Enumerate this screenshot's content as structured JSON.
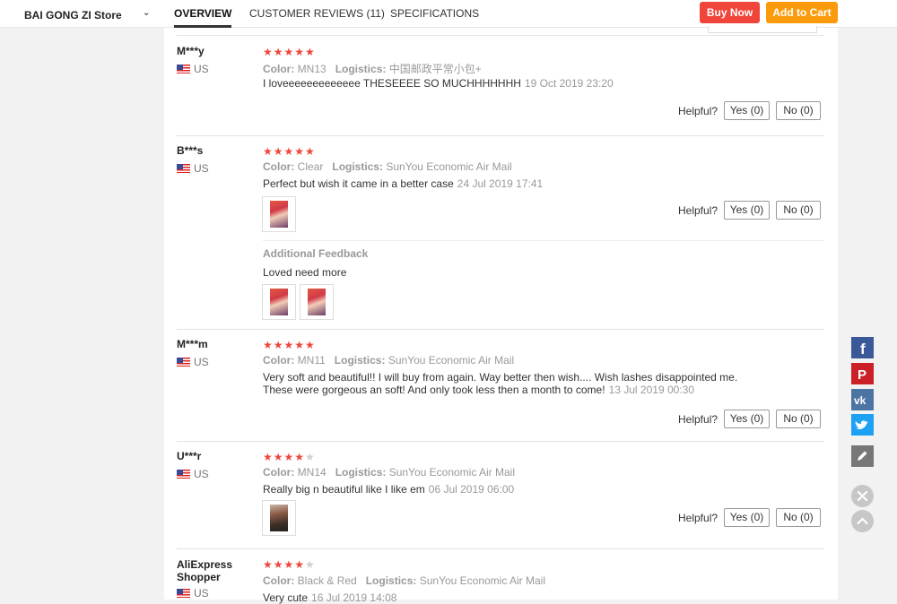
{
  "store": {
    "name": "BAI GONG ZI Store"
  },
  "tabs": [
    {
      "label": "OVERVIEW"
    },
    {
      "label": "CUSTOMER REVIEWS (11)"
    },
    {
      "label": "SPECIFICATIONS"
    }
  ],
  "actions": {
    "buy_now": "Buy Now",
    "add_to_cart": "Add to Cart"
  },
  "labels": {
    "color": "Color:",
    "logistics": "Logistics:",
    "helpful": "Helpful?",
    "yes": "Yes (0)",
    "no": "No (0)",
    "additional_feedback": "Additional Feedback"
  },
  "reviews": [
    {
      "user": "M***y",
      "country": "US",
      "rating": 5,
      "color": "MN13",
      "logistics": "中国邮政平常小包+",
      "text": "I loveeeeeeeeeeeee THESEEEE SO MUCHHHHHHH",
      "date": "19 Oct 2019 23:20"
    },
    {
      "user": "B***s",
      "country": "US",
      "rating": 5,
      "color": "Clear",
      "logistics": "SunYou Economic Air Mail",
      "text": "Perfect but wish it came in a better case",
      "date": "24 Jul 2019 17:41",
      "additional_feedback": "Loved need more"
    },
    {
      "user": "M***m",
      "country": "US",
      "rating": 5,
      "color": "MN11",
      "logistics": "SunYou Economic Air Mail",
      "text_line1": "Very soft and beautiful!! I will buy from again. Way better then wish.... Wish lashes disappointed me.",
      "text_line2": "These were gorgeous an soft! And only took less then a month to come!",
      "date": "13 Jul 2019 00:30"
    },
    {
      "user": "U***r",
      "country": "US",
      "rating": 4,
      "color": "MN14",
      "logistics": "SunYou Economic Air Mail",
      "text": "Really big n beautiful like I like em",
      "date": "06 Jul 2019 06:00"
    },
    {
      "user_line1": "AliExpress",
      "user_line2": "Shopper",
      "country": "US",
      "rating": 4,
      "color": "Black & Red",
      "logistics": "SunYou Economic Air Mail",
      "text": "Very cute",
      "date": "16 Jul 2019 14:08"
    }
  ]
}
